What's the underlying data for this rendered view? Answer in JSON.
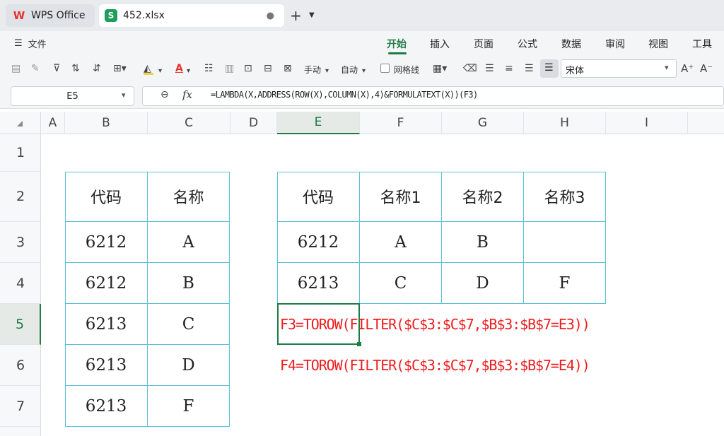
{
  "tabs": {
    "home": "WPS Office",
    "file": "452.xlsx",
    "file_logo": "S",
    "new_tab": "+"
  },
  "menu": {
    "file_label": "文件",
    "ribbon_tabs": [
      "开始",
      "插入",
      "页面",
      "公式",
      "数据",
      "审阅",
      "视图",
      "工具"
    ],
    "active_tab": "开始"
  },
  "toolbar": {
    "manual_label": "手动",
    "auto_label": "自动",
    "gridlines_label": "网格线",
    "font_name": "宋体",
    "font_color": "#e8312a",
    "fill_color": "#f2d43d"
  },
  "formula_bar": {
    "cell_ref": "E5",
    "fx": "fx",
    "formula": "=LAMBDA(X,ADDRESS(ROW(X),COLUMN(X),4)&FORMULATEXT(X))(F3)"
  },
  "columns": [
    "A",
    "B",
    "C",
    "D",
    "E",
    "F",
    "G",
    "H",
    "I"
  ],
  "active_column": "E",
  "rows": [
    "1",
    "2",
    "3",
    "4",
    "5",
    "6",
    "7"
  ],
  "active_row": "5",
  "left_table": {
    "headers": [
      "代码",
      "名称"
    ],
    "rows": [
      [
        "6212",
        "A"
      ],
      [
        "6212",
        "B"
      ],
      [
        "6213",
        "C"
      ],
      [
        "6213",
        "D"
      ],
      [
        "6213",
        "F"
      ]
    ]
  },
  "right_table": {
    "headers": [
      "代码",
      "名称1",
      "名称2",
      "名称3"
    ],
    "rows": [
      [
        "6212",
        "A",
        "B",
        ""
      ],
      [
        "6213",
        "C",
        "D",
        "F"
      ]
    ]
  },
  "notes": [
    "F3=TOROW(FILTER($C$3:$C$7,$B$3:$B$7=E3))",
    "F4=TOROW(FILTER($C$3:$C$7,$B$3:$B$7=E4))"
  ],
  "colors": {
    "accent": "#1f7c46",
    "grid_border": "#5bc3d6",
    "note_text": "#ee1c1c"
  }
}
